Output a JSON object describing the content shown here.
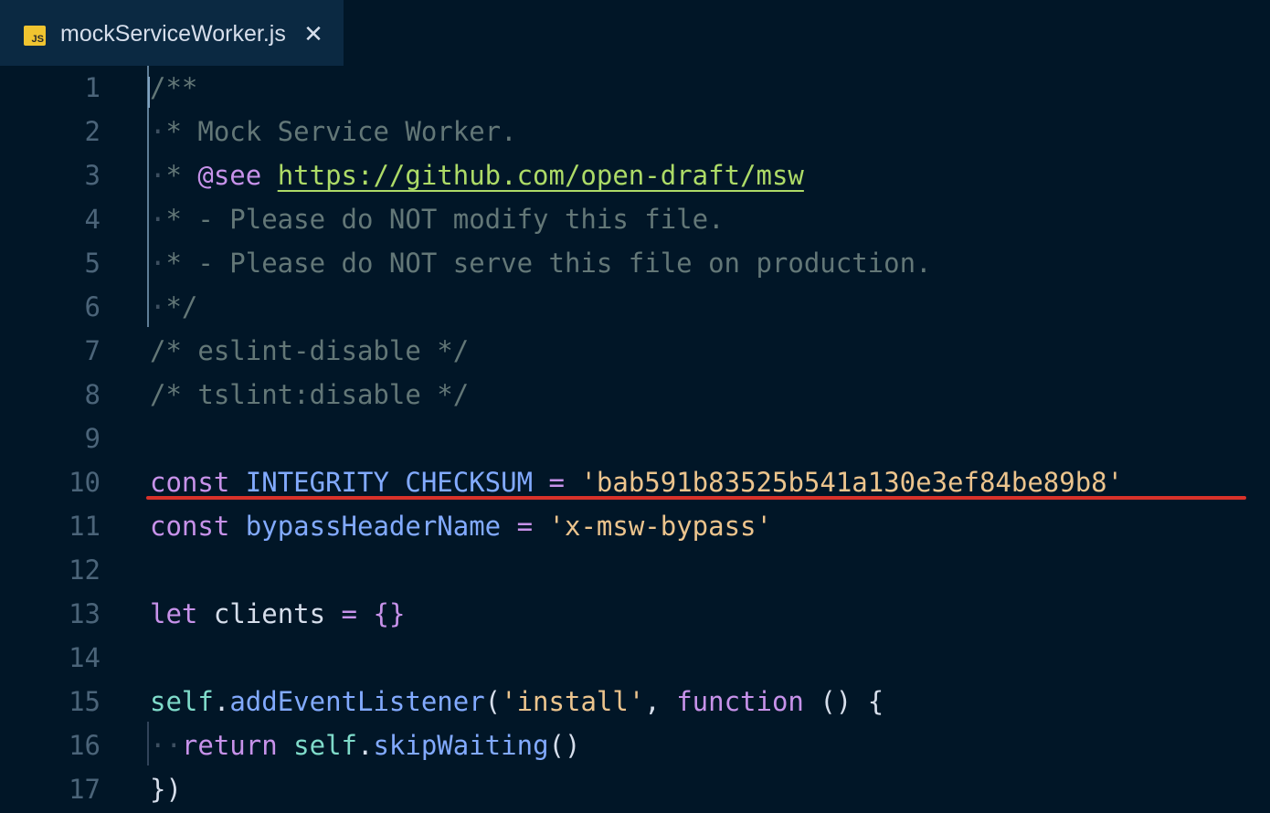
{
  "tab": {
    "file_icon_text": "JS",
    "title": "mockServiceWorker.js",
    "close_glyph": "✕"
  },
  "lines": [
    {
      "n": "1"
    },
    {
      "n": "2"
    },
    {
      "n": "3"
    },
    {
      "n": "4"
    },
    {
      "n": "5"
    },
    {
      "n": "6"
    },
    {
      "n": "7"
    },
    {
      "n": "8"
    },
    {
      "n": "9"
    },
    {
      "n": "10"
    },
    {
      "n": "11"
    },
    {
      "n": "12"
    },
    {
      "n": "13"
    },
    {
      "n": "14"
    },
    {
      "n": "15"
    },
    {
      "n": "16"
    },
    {
      "n": "17"
    }
  ],
  "code": {
    "l1": "/**",
    "l2_dot": "·",
    "l2_text": "* Mock Service Worker.",
    "l3_dot": "·",
    "l3_star": "* ",
    "l3_tag": "@see",
    "l3_sp": " ",
    "l3_link": "https://github.com/open-draft/msw",
    "l4_dot": "·",
    "l4_text": "* - Please do NOT modify this file.",
    "l5_dot": "·",
    "l5_text": "* - Please do NOT serve this file on production.",
    "l6_dot": "·",
    "l6_text": "*/",
    "l7": "/* eslint-disable */",
    "l8": "/* tslint:disable */",
    "l10_kw": "const",
    "l10_name": "INTEGRITY_CHECKSUM",
    "l10_op": "=",
    "l10_str": "'bab591b83525b541a130e3ef84be89b8'",
    "l11_kw": "const",
    "l11_name": "bypassHeaderName",
    "l11_op": "=",
    "l11_str": "'x-msw-bypass'",
    "l13_kw": "let",
    "l13_name": "clients",
    "l13_op": "=",
    "l13_val": "{}",
    "l15_self": "self",
    "l15_dot": ".",
    "l15_fn": "addEventListener",
    "l15_p1": "(",
    "l15_str": "'install'",
    "l15_comma": ", ",
    "l15_kw": "function",
    "l15_rest": " () {",
    "l16_dot": "··",
    "l16_kw": "return",
    "l16_self": "self",
    "l16_period": ".",
    "l16_fn": "skipWaiting",
    "l16_call": "()",
    "l17": "})"
  },
  "colors": {
    "background": "#011627",
    "highlight_underline": "#d9322a"
  }
}
